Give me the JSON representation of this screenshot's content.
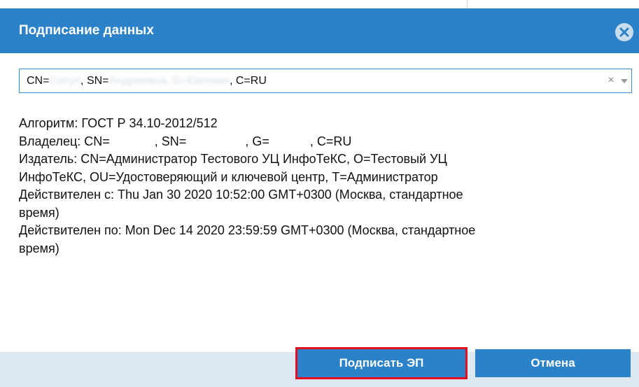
{
  "dialog": {
    "title": "Подписание данных"
  },
  "certificate_select": {
    "value_parts": [
      "CN=",
      "Сотул",
      ", SN=",
      "Андреевна",
      ", G=",
      "Евгения",
      ", C=RU"
    ],
    "clear_glyph": "×"
  },
  "details": {
    "algorithm": "Алгоритм: ГОСТ Р 34.10-2012/512",
    "owner_prefix": "Владелец: CN=",
    "owner_sn": ", SN=",
    "owner_g": ", G=",
    "owner_c": ", C=RU",
    "issuer_line1": "Издатель: CN=Администратор Тестового УЦ ИнфоТеКС, O=Тестовый УЦ",
    "issuer_line2": "ИнфоТеКС, OU=Удостоверяющий и ключевой центр, T=Администратор",
    "valid_from_line1": "Действителен с: Thu Jan 30 2020 10:52:00 GMT+0300 (Москва, стандартное",
    "valid_from_line2": "время)",
    "valid_to_line1": "Действителен по: Mon Dec 14 2020 23:59:59 GMT+0300 (Москва, стандартное",
    "valid_to_line2": "время)"
  },
  "buttons": {
    "sign_label": "Подписать ЭП",
    "cancel_label": "Отмена"
  },
  "colors": {
    "header": "#2b82c9",
    "footer": "#dde8f1",
    "highlight": "#e2101c"
  }
}
